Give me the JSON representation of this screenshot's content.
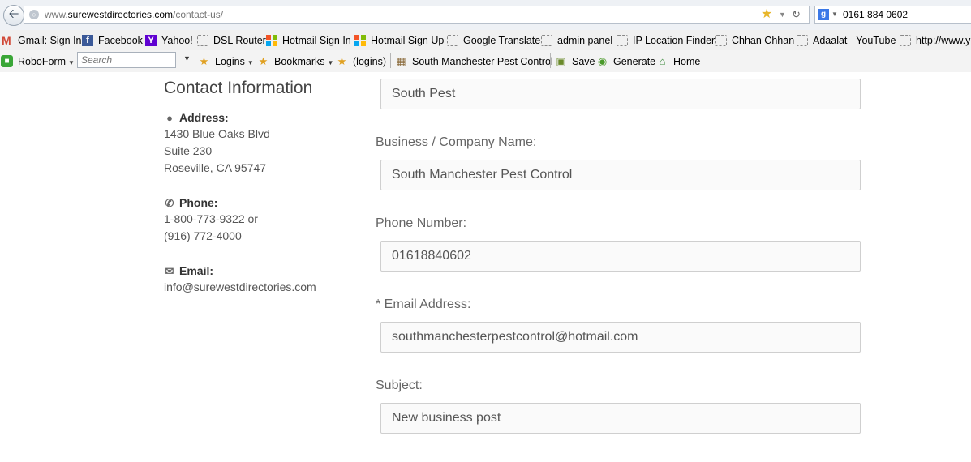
{
  "browser": {
    "url_prefix": "www.",
    "url_domain": "surewestdirectories.com",
    "url_path": "/contact-us/",
    "search_engine_glyph": "g",
    "search_query": "0161 884 0602"
  },
  "bookmarks": [
    {
      "label": "Gmail: Sign In",
      "icon": "gmail-icon"
    },
    {
      "label": "Facebook",
      "icon": "facebook-icon"
    },
    {
      "label": "Yahoo!",
      "icon": "yahoo-icon"
    },
    {
      "label": "DSL Router",
      "icon": "blank-page-icon"
    },
    {
      "label": "Hotmail Sign In",
      "icon": "windows-icon"
    },
    {
      "label": "Hotmail Sign Up",
      "icon": "windows-icon"
    },
    {
      "label": "Google Translate",
      "icon": "blank-page-icon"
    },
    {
      "label": "admin panel",
      "icon": "blank-page-icon"
    },
    {
      "label": "IP Location Finder",
      "icon": "blank-page-icon"
    },
    {
      "label": "Chhan Chhan",
      "icon": "blank-page-icon"
    },
    {
      "label": "Adaalat - YouTube",
      "icon": "blank-page-icon"
    },
    {
      "label": "http://www.y",
      "icon": "blank-page-icon"
    }
  ],
  "toolbar": {
    "roboform": "RoboForm",
    "search_placeholder": "Search",
    "logins": "Logins",
    "bookmarks": "Bookmarks",
    "logins_paren": "(logins)",
    "site_login": "South Manchester Pest Control",
    "save": "Save",
    "generate": "Generate",
    "home": "Home"
  },
  "contact": {
    "heading": "Contact Information",
    "address_title": "Address:",
    "address_lines": [
      "1430 Blue Oaks Blvd",
      "Suite 230",
      "Roseville, CA 95747"
    ],
    "phone_title": "Phone:",
    "phone_lines": [
      "1-800-773-9322 or",
      "(916) 772-4000"
    ],
    "email_title": "Email:",
    "email_value": "info@surewestdirectories.com"
  },
  "form": {
    "name_value": "South Pest",
    "company_label": "Business / Company Name:",
    "company_value": "South Manchester Pest Control",
    "phone_label": "Phone Number:",
    "phone_value": "01618840602",
    "email_label": "* Email Address:",
    "email_value": "southmanchesterpestcontrol@hotmail.com",
    "subject_label": "Subject:",
    "subject_value": "New business post"
  }
}
